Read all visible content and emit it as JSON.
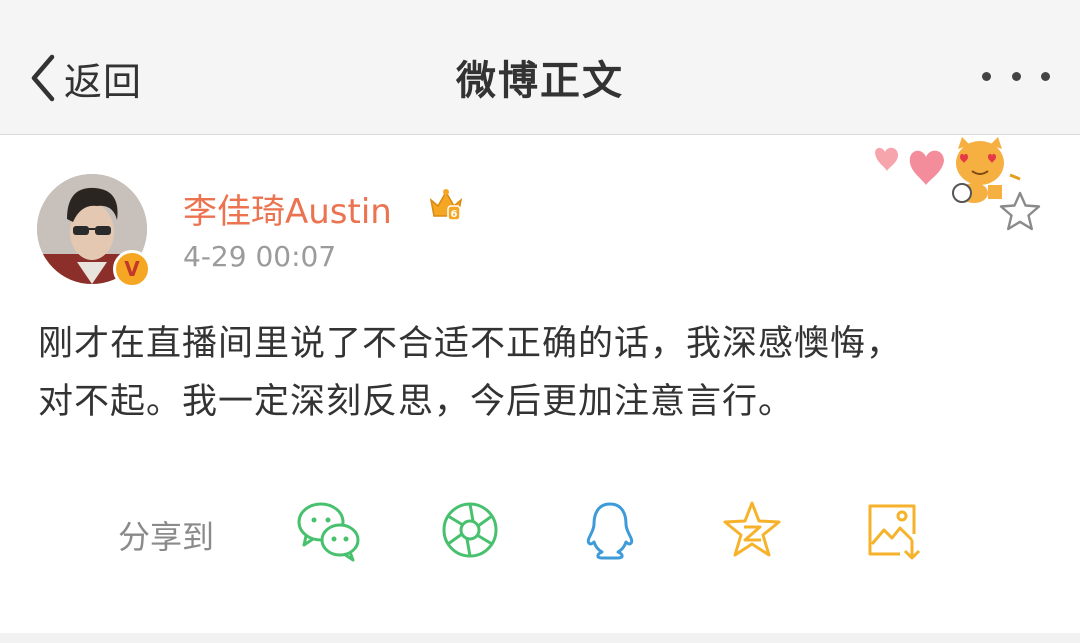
{
  "nav": {
    "back_label": "返回",
    "title": "微博正文",
    "back_icon": "chevron-left-icon",
    "more_icon": "more-dots-icon"
  },
  "post": {
    "author": "李佳琦Austin",
    "time": "4-29 00:07",
    "verified_mark": "V",
    "member_badge": "crown-icon",
    "sticker": "cat-hearts-sticker",
    "favorite_icon": "star-icon",
    "content_lines": [
      "刚才在直播间里说了不合适不正确的话，我深感懊悔，",
      "对不起。我一定深刻反思，今后更加注意言行。"
    ]
  },
  "share": {
    "label": "分享到",
    "targets": [
      {
        "name": "wechat-icon",
        "color": "#48c16e"
      },
      {
        "name": "wechat-moments-icon",
        "color": "#48c16e"
      },
      {
        "name": "qq-icon",
        "color": "#3e9bd9"
      },
      {
        "name": "qzone-icon",
        "color": "#f6b22a"
      },
      {
        "name": "save-image-icon",
        "color": "#f6b22a"
      }
    ]
  },
  "colors": {
    "accent": "#eb7350",
    "text": "#333333",
    "muted": "#9b9b9b",
    "navbar": "#f5f5f5"
  }
}
